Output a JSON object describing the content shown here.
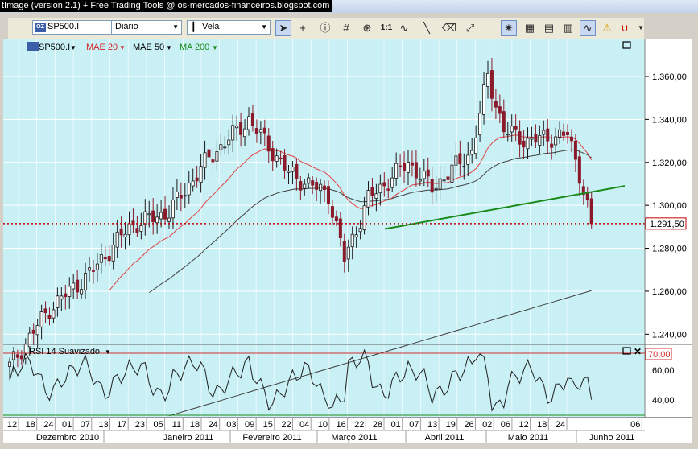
{
  "window": {
    "title": "tImage (version 2.1) + Free Trading Tools @ os-mercados-financeiros.blogspot.com"
  },
  "toolbar": {
    "symbol": "SP500.I",
    "timeframe": "Diário",
    "chart_style": "Vela",
    "tools": [
      "cursor-arrow-icon",
      "crosshair-icon",
      "info-icon",
      "grid-icon",
      "zoom-icon",
      "one-to-one-icon",
      "wave-icon",
      "trendline-icon",
      "eraser-icon",
      "arrow-tool-icon",
      "magnet-icon",
      "indicator-a-icon",
      "indicator-b-icon",
      "indicator-c-icon",
      "wave-b-icon",
      "warning-icon",
      "magnet-u-icon"
    ],
    "one_to_one_label": "1:1"
  },
  "legend": {
    "symbol": "SP500.I",
    "mae20": "MAE 20",
    "mae50": "MAE 50",
    "ma200": "MA 200"
  },
  "colors": {
    "bg": "#c9f0f5",
    "up": "#1a1a1a",
    "down": "#8b1a2a",
    "mae20": "#e04040",
    "mae50": "#404040",
    "ma200": "#404040",
    "support": "#1a8a1a",
    "current": "#c00000",
    "rsi_top": "#d03030",
    "rsi_bottom": "#1a8a1a"
  },
  "price_axis": {
    "labels": [
      "1.360,00",
      "1.340,00",
      "1.320,00",
      "1.300,00",
      "1.280,00",
      "1.260,00",
      "1.240,00"
    ],
    "current_label": "1.291,50"
  },
  "rsi": {
    "title": "RSI 14 Suavizado",
    "labels": [
      "60,00",
      "40,00"
    ],
    "overbought_label": "70,00"
  },
  "time_axis": {
    "days": [
      "12",
      "18",
      "24",
      "01",
      "07",
      "13",
      "17",
      "23",
      "05",
      "11",
      "18",
      "24",
      "03",
      "09",
      "15",
      "22",
      "04",
      "10",
      "16",
      "22",
      "28",
      "01",
      "07",
      "13",
      "19",
      "26",
      "02",
      "06",
      "12",
      "18",
      "24",
      "06"
    ],
    "months": [
      "Dezembro 2010",
      "Janeiro 2011",
      "Fevereiro 2011",
      "Março 2011",
      "Abril 2011",
      "Maio 2011",
      "Junho 2011"
    ]
  },
  "chart_data": {
    "type": "candlestick",
    "symbol": "SP500.I",
    "timeframe": "Diário",
    "x_range": [
      "Dec 2010",
      "Jun 2011"
    ],
    "y_range": [
      1230,
      1378
    ],
    "current_price": 1291.5,
    "indicators": [
      "MAE 20",
      "MAE 50",
      "MA 200"
    ],
    "anchors": {
      "x": [
        0,
        10,
        20,
        30,
        40,
        50,
        60,
        70,
        80,
        84,
        90,
        100,
        106,
        116,
        120,
        124,
        130,
        140,
        143,
        146
      ],
      "close": [
        1225,
        1252,
        1268,
        1290,
        1297,
        1322,
        1340,
        1315,
        1305,
        1275,
        1303,
        1320,
        1308,
        1325,
        1360,
        1335,
        1330,
        1333,
        1315,
        1291.5
      ]
    },
    "support_line": {
      "start": [
        1288,
        1289
      ],
      "end": [
        1310,
        1309
      ]
    },
    "rsi_overbought": 70,
    "rsi_range": [
      30,
      80
    ]
  }
}
